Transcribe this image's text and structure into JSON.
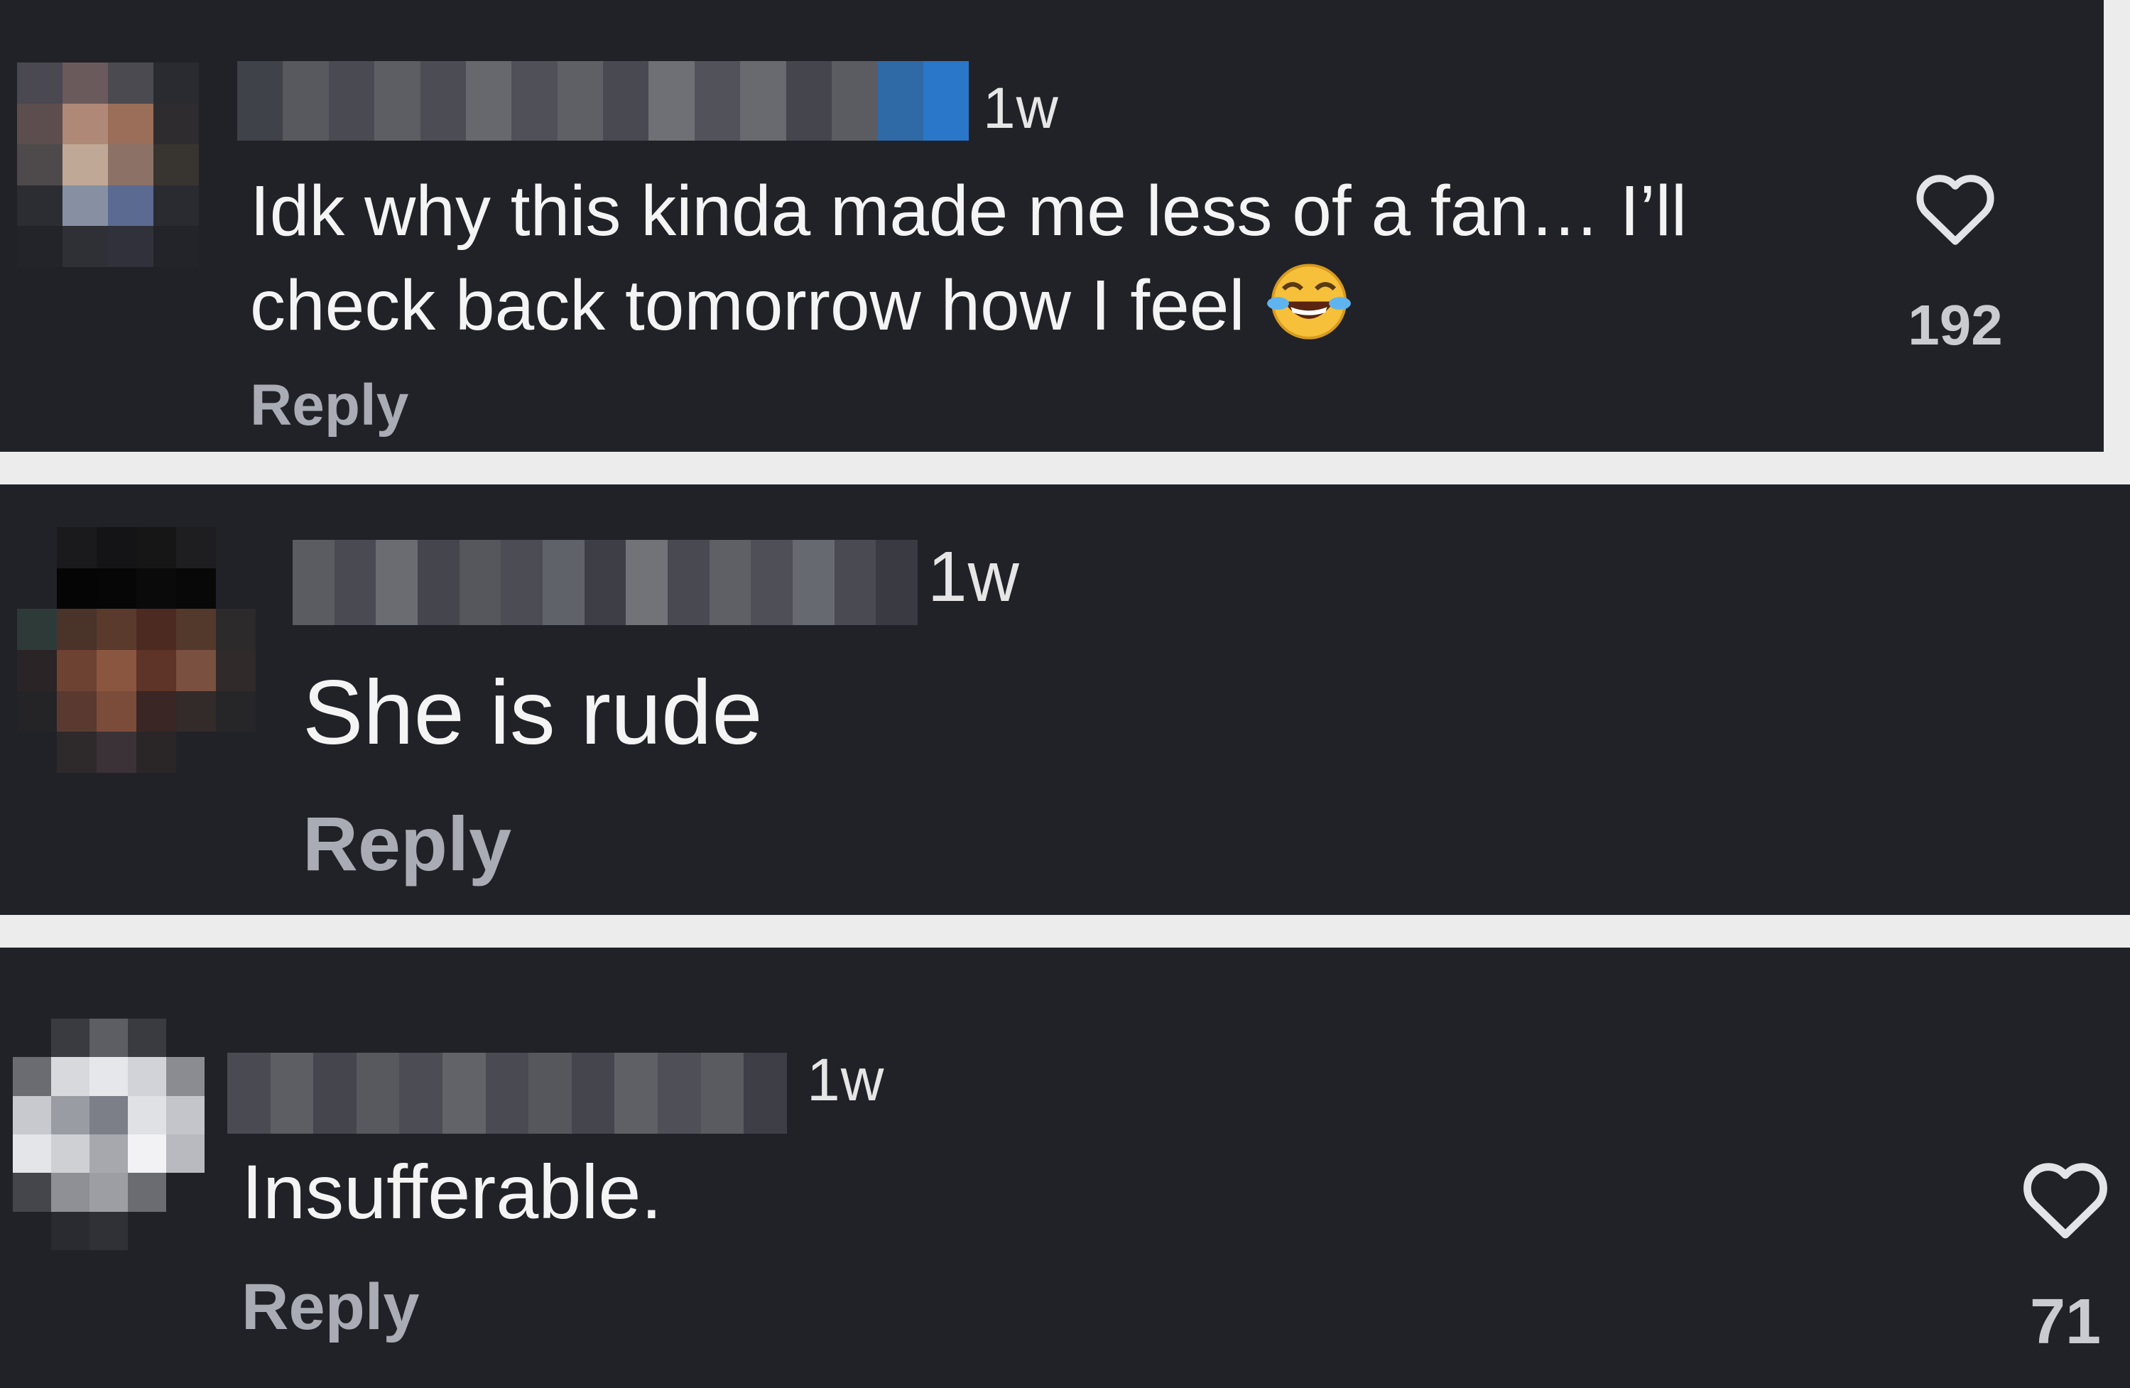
{
  "colors": {
    "panel_bg": "#212227",
    "separator": "#ececec",
    "text": "#f4f4f4",
    "reply": "#a9acb4",
    "likes": "#c9cbd1"
  },
  "comments": [
    {
      "time": "1w",
      "text_lines": [
        "Idk why this kinda made me less of a fan… I’ll",
        "check back tomorrow how I feel"
      ],
      "emoji": "face-with-tears-of-joy",
      "reply": "Reply",
      "likes": "192",
      "like_icon": "heart-outline-icon"
    },
    {
      "time": "1w",
      "text_lines": [
        "She is rude"
      ],
      "reply": "Reply"
    },
    {
      "time": "1w",
      "text_lines": [
        "Insufferable."
      ],
      "reply": "Reply",
      "likes": "71",
      "like_icon": "heart-outline-icon"
    }
  ]
}
